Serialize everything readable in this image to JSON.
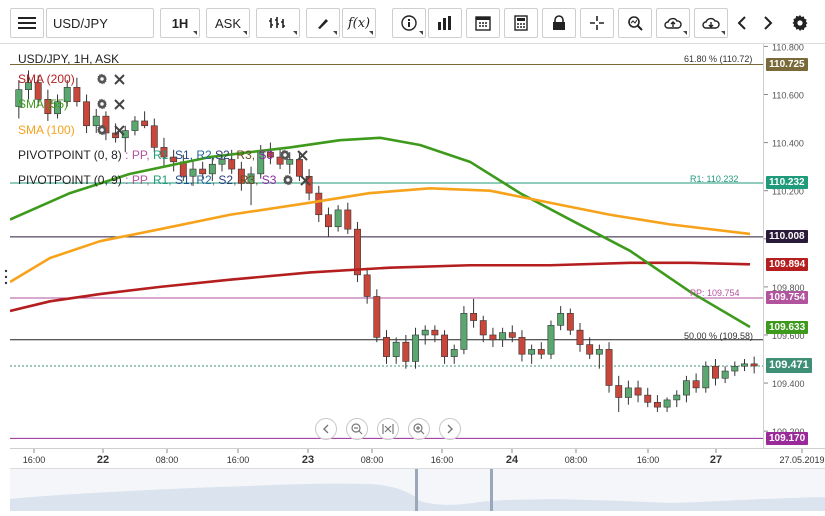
{
  "toolbar": {
    "menu_icon": "hamburger-icon",
    "symbol": "USD/JPY",
    "timeframe": "1H",
    "price_type": "ASK",
    "tools": [
      "bar-chart-type-icon",
      "draw-pencil-icon",
      "function-fx-icon",
      "info-icon",
      "volume-bars-icon",
      "calendar-icon",
      "calculator-icon",
      "lock-icon",
      "crosshair-icon",
      "zoom-search-icon",
      "cloud-upload-icon",
      "cloud-download-icon",
      "arrow-left-icon",
      "arrow-right-icon",
      "settings-gear-icon"
    ],
    "fx_label": "f(x)"
  },
  "chart": {
    "title": "USD/JPY, 1H, ASK"
  },
  "indicators": [
    {
      "label": "SMA (200)",
      "color": "#b41e1e"
    },
    {
      "label": "SMA (55)",
      "color": "#3d9a1c"
    },
    {
      "label": "SMA (100)",
      "color": "#f7a21b"
    }
  ],
  "pivots": [
    {
      "name": "PIVOTPOINT (0, 8)",
      "parts": [
        ": PP,",
        "R1,",
        "S1,",
        "R2,",
        "S2,",
        "R3,",
        "S3"
      ]
    },
    {
      "name": "PIVOTPOINT (0, 9)",
      "parts": [
        ": PP,",
        "R1,",
        "S1,",
        "R2,",
        "S2,",
        "R3,",
        "S3"
      ]
    }
  ],
  "annotations": {
    "fib_618": "61.80 % (110.72)",
    "fib_500": "50.00 % (109.58)",
    "r1": "R1: 110.232",
    "pp": "PP: 109.754"
  },
  "price_tags": [
    {
      "value": "110.725",
      "color": "#7a6a3a"
    },
    {
      "value": "110.232",
      "color": "#1f9a7a"
    },
    {
      "value": "110.008",
      "color": "#2a1a3a"
    },
    {
      "value": "109.894",
      "color": "#b41e1e"
    },
    {
      "value": "109.754",
      "color": "#b2539e"
    },
    {
      "value": "109.633",
      "color": "#3d9a1c"
    },
    {
      "value": "109.471",
      "color": "#3f8f76"
    },
    {
      "value": "109.170",
      "color": "#9a2a9a"
    }
  ],
  "chart_data": {
    "type": "candlestick",
    "y_ticks": [
      "110.800",
      "110.600",
      "110.400",
      "110.200",
      "110.000",
      "109.800",
      "109.600",
      "109.400",
      "109.200"
    ],
    "ylim": [
      109.13,
      110.81
    ],
    "x_ticks": [
      "16:00",
      "22",
      "08:00",
      "16:00",
      "23",
      "08:00",
      "16:00",
      "24",
      "08:00",
      "16:00",
      "27",
      "27.05.2019"
    ],
    "horizontal_lines": [
      {
        "label": "61.80 %",
        "value": 110.725,
        "color": "#7a6a3a"
      },
      {
        "label": "R1",
        "value": 110.232,
        "color": "#1f9a7a"
      },
      {
        "label": "",
        "value": 110.008,
        "color": "#2a1a3a"
      },
      {
        "label": "PP",
        "value": 109.754,
        "color": "#b2539e"
      },
      {
        "label": "50.00 %",
        "value": 109.58,
        "color": "#222222"
      },
      {
        "label": "",
        "value": 109.17,
        "color": "#9a2a9a"
      },
      {
        "label": "last",
        "value": 109.471,
        "color": "#3f8f76"
      }
    ],
    "series": [
      {
        "name": "SMA (200)",
        "color": "#b41e1e",
        "points": [
          [
            0,
            109.7
          ],
          [
            40,
            109.74
          ],
          [
            90,
            109.77
          ],
          [
            150,
            109.8
          ],
          [
            220,
            109.83
          ],
          [
            300,
            109.86
          ],
          [
            380,
            109.88
          ],
          [
            460,
            109.89
          ],
          [
            540,
            109.89
          ],
          [
            620,
            109.9
          ],
          [
            680,
            109.9
          ],
          [
            740,
            109.894
          ]
        ]
      },
      {
        "name": "SMA (55)",
        "color": "#3d9a1c",
        "points": [
          [
            0,
            110.08
          ],
          [
            60,
            110.19
          ],
          [
            120,
            110.27
          ],
          [
            200,
            110.34
          ],
          [
            280,
            110.38
          ],
          [
            330,
            110.41
          ],
          [
            370,
            110.42
          ],
          [
            410,
            110.39
          ],
          [
            460,
            110.32
          ],
          [
            510,
            110.19
          ],
          [
            560,
            110.08
          ],
          [
            620,
            109.95
          ],
          [
            680,
            109.78
          ],
          [
            740,
            109.633
          ]
        ]
      },
      {
        "name": "SMA (100)",
        "color": "#f7a21b",
        "points": [
          [
            0,
            109.82
          ],
          [
            40,
            109.92
          ],
          [
            90,
            109.99
          ],
          [
            150,
            110.04
          ],
          [
            220,
            110.1
          ],
          [
            300,
            110.15
          ],
          [
            360,
            110.19
          ],
          [
            420,
            110.21
          ],
          [
            480,
            110.2
          ],
          [
            540,
            110.15
          ],
          [
            600,
            110.1
          ],
          [
            660,
            110.06
          ],
          [
            740,
            110.02
          ]
        ]
      }
    ],
    "candles": [
      {
        "o": 110.55,
        "h": 110.66,
        "l": 110.5,
        "c": 110.62
      },
      {
        "o": 110.62,
        "h": 110.7,
        "l": 110.58,
        "c": 110.65
      },
      {
        "o": 110.65,
        "h": 110.68,
        "l": 110.55,
        "c": 110.58
      },
      {
        "o": 110.58,
        "h": 110.62,
        "l": 110.49,
        "c": 110.52
      },
      {
        "o": 110.52,
        "h": 110.6,
        "l": 110.5,
        "c": 110.57
      },
      {
        "o": 110.57,
        "h": 110.66,
        "l": 110.55,
        "c": 110.63
      },
      {
        "o": 110.63,
        "h": 110.67,
        "l": 110.55,
        "c": 110.57
      },
      {
        "o": 110.57,
        "h": 110.6,
        "l": 110.44,
        "c": 110.47
      },
      {
        "o": 110.47,
        "h": 110.54,
        "l": 110.44,
        "c": 110.51
      },
      {
        "o": 110.51,
        "h": 110.53,
        "l": 110.41,
        "c": 110.44
      },
      {
        "o": 110.44,
        "h": 110.48,
        "l": 110.4,
        "c": 110.42
      },
      {
        "o": 110.42,
        "h": 110.47,
        "l": 110.36,
        "c": 110.45
      },
      {
        "o": 110.45,
        "h": 110.51,
        "l": 110.43,
        "c": 110.49
      },
      {
        "o": 110.49,
        "h": 110.53,
        "l": 110.46,
        "c": 110.47
      },
      {
        "o": 110.47,
        "h": 110.5,
        "l": 110.36,
        "c": 110.38
      },
      {
        "o": 110.38,
        "h": 110.42,
        "l": 110.3,
        "c": 110.34
      },
      {
        "o": 110.34,
        "h": 110.37,
        "l": 110.28,
        "c": 110.32
      },
      {
        "o": 110.32,
        "h": 110.35,
        "l": 110.24,
        "c": 110.26
      },
      {
        "o": 110.26,
        "h": 110.33,
        "l": 110.22,
        "c": 110.29
      },
      {
        "o": 110.29,
        "h": 110.32,
        "l": 110.25,
        "c": 110.27
      },
      {
        "o": 110.27,
        "h": 110.34,
        "l": 110.24,
        "c": 110.31
      },
      {
        "o": 110.31,
        "h": 110.36,
        "l": 110.28,
        "c": 110.33
      },
      {
        "o": 110.33,
        "h": 110.37,
        "l": 110.27,
        "c": 110.29
      },
      {
        "o": 110.29,
        "h": 110.32,
        "l": 110.2,
        "c": 110.23
      },
      {
        "o": 110.23,
        "h": 110.3,
        "l": 110.14,
        "c": 110.27
      },
      {
        "o": 110.27,
        "h": 110.39,
        "l": 110.25,
        "c": 110.36
      },
      {
        "o": 110.36,
        "h": 110.4,
        "l": 110.31,
        "c": 110.34
      },
      {
        "o": 110.34,
        "h": 110.37,
        "l": 110.29,
        "c": 110.31
      },
      {
        "o": 110.31,
        "h": 110.36,
        "l": 110.27,
        "c": 110.33
      },
      {
        "o": 110.33,
        "h": 110.36,
        "l": 110.24,
        "c": 110.26
      },
      {
        "o": 110.26,
        "h": 110.29,
        "l": 110.16,
        "c": 110.19
      },
      {
        "o": 110.19,
        "h": 110.22,
        "l": 110.07,
        "c": 110.1
      },
      {
        "o": 110.1,
        "h": 110.13,
        "l": 110.01,
        "c": 110.05
      },
      {
        "o": 110.05,
        "h": 110.14,
        "l": 110.03,
        "c": 110.12
      },
      {
        "o": 110.12,
        "h": 110.15,
        "l": 110.02,
        "c": 110.04
      },
      {
        "o": 110.04,
        "h": 110.07,
        "l": 109.82,
        "c": 109.85
      },
      {
        "o": 109.85,
        "h": 109.88,
        "l": 109.73,
        "c": 109.76
      },
      {
        "o": 109.76,
        "h": 109.79,
        "l": 109.57,
        "c": 109.59
      },
      {
        "o": 109.59,
        "h": 109.62,
        "l": 109.48,
        "c": 109.51
      },
      {
        "o": 109.51,
        "h": 109.59,
        "l": 109.48,
        "c": 109.57
      },
      {
        "o": 109.57,
        "h": 109.6,
        "l": 109.46,
        "c": 109.49
      },
      {
        "o": 109.49,
        "h": 109.63,
        "l": 109.46,
        "c": 109.6
      },
      {
        "o": 109.6,
        "h": 109.64,
        "l": 109.56,
        "c": 109.62
      },
      {
        "o": 109.62,
        "h": 109.64,
        "l": 109.57,
        "c": 109.6
      },
      {
        "o": 109.6,
        "h": 109.62,
        "l": 109.48,
        "c": 109.51
      },
      {
        "o": 109.51,
        "h": 109.56,
        "l": 109.48,
        "c": 109.54
      },
      {
        "o": 109.54,
        "h": 109.72,
        "l": 109.52,
        "c": 109.69
      },
      {
        "o": 109.69,
        "h": 109.75,
        "l": 109.63,
        "c": 109.66
      },
      {
        "o": 109.66,
        "h": 109.68,
        "l": 109.57,
        "c": 109.6
      },
      {
        "o": 109.6,
        "h": 109.63,
        "l": 109.55,
        "c": 109.58
      },
      {
        "o": 109.58,
        "h": 109.63,
        "l": 109.55,
        "c": 109.61
      },
      {
        "o": 109.61,
        "h": 109.64,
        "l": 109.57,
        "c": 109.59
      },
      {
        "o": 109.59,
        "h": 109.62,
        "l": 109.49,
        "c": 109.52
      },
      {
        "o": 109.52,
        "h": 109.56,
        "l": 109.48,
        "c": 109.54
      },
      {
        "o": 109.54,
        "h": 109.57,
        "l": 109.5,
        "c": 109.52
      },
      {
        "o": 109.52,
        "h": 109.66,
        "l": 109.5,
        "c": 109.64
      },
      {
        "o": 109.64,
        "h": 109.72,
        "l": 109.62,
        "c": 109.69
      },
      {
        "o": 109.69,
        "h": 109.71,
        "l": 109.6,
        "c": 109.62
      },
      {
        "o": 109.62,
        "h": 109.65,
        "l": 109.53,
        "c": 109.56
      },
      {
        "o": 109.56,
        "h": 109.59,
        "l": 109.5,
        "c": 109.52
      },
      {
        "o": 109.52,
        "h": 109.56,
        "l": 109.46,
        "c": 109.54
      },
      {
        "o": 109.54,
        "h": 109.57,
        "l": 109.36,
        "c": 109.39
      },
      {
        "o": 109.39,
        "h": 109.43,
        "l": 109.28,
        "c": 109.34
      },
      {
        "o": 109.34,
        "h": 109.41,
        "l": 109.31,
        "c": 109.38
      },
      {
        "o": 109.38,
        "h": 109.41,
        "l": 109.32,
        "c": 109.35
      },
      {
        "o": 109.35,
        "h": 109.38,
        "l": 109.3,
        "c": 109.32
      },
      {
        "o": 109.32,
        "h": 109.35,
        "l": 109.28,
        "c": 109.3
      },
      {
        "o": 109.3,
        "h": 109.34,
        "l": 109.28,
        "c": 109.33
      },
      {
        "o": 109.33,
        "h": 109.37,
        "l": 109.3,
        "c": 109.35
      },
      {
        "o": 109.35,
        "h": 109.43,
        "l": 109.32,
        "c": 109.41
      },
      {
        "o": 109.41,
        "h": 109.44,
        "l": 109.36,
        "c": 109.38
      },
      {
        "o": 109.38,
        "h": 109.49,
        "l": 109.36,
        "c": 109.47
      },
      {
        "o": 109.47,
        "h": 109.5,
        "l": 109.39,
        "c": 109.42
      },
      {
        "o": 109.42,
        "h": 109.47,
        "l": 109.4,
        "c": 109.45
      },
      {
        "o": 109.45,
        "h": 109.49,
        "l": 109.43,
        "c": 109.47
      },
      {
        "o": 109.47,
        "h": 109.5,
        "l": 109.45,
        "c": 109.48
      },
      {
        "o": 109.48,
        "h": 109.51,
        "l": 109.44,
        "c": 109.471
      }
    ],
    "up_color": "#5aa870",
    "down_color": "#c9473a"
  },
  "zoom_controls": [
    "arrow-left-circle-icon",
    "zoom-out-icon",
    "reset-zoom-icon",
    "zoom-in-icon",
    "arrow-right-circle-icon"
  ]
}
